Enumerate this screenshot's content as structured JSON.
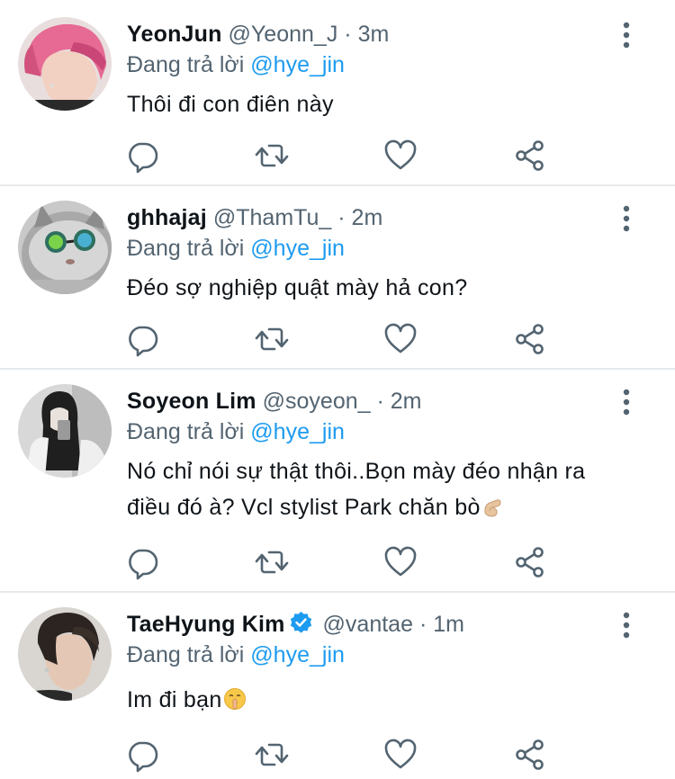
{
  "colors": {
    "accent": "#1d9bf0",
    "text_primary": "#0f1419",
    "text_secondary": "#536471",
    "divider": "#e6e9ec",
    "icon": "#536471"
  },
  "tweets": [
    {
      "display_name": "YeonJun",
      "handle": "@Yeonn_J",
      "separator": "·",
      "time": "3m",
      "reply_prefix": "Đang trả lời",
      "reply_to": "@hye_jin",
      "text": "Thôi đi con điên này",
      "verified": false,
      "avatar_icon": "avatar-pink-hair-person"
    },
    {
      "display_name": "ghhajaj",
      "handle": "@ThamTu_",
      "separator": "·",
      "time": "2m",
      "reply_prefix": "Đang trả lời",
      "reply_to": "@hye_jin",
      "text": "Đéo sợ nghiệp quật mày hả con?",
      "verified": false,
      "avatar_icon": "avatar-cat-with-sunglasses"
    },
    {
      "display_name": "Soyeon Lim",
      "handle": "@soyeon_",
      "separator": "·",
      "time": "2m",
      "reply_prefix": "Đang trả lời",
      "reply_to": "@hye_jin",
      "text_line1": "Nó chỉ nói sự thật thôi..Bọn mày đéo nhận ra",
      "text_line2": "điều đó à? Vcl stylist Park chăn bò",
      "verified": false,
      "avatar_icon": "avatar-mirror-selfie"
    },
    {
      "display_name": "TaeHyung Kim",
      "handle": "@vantae",
      "separator": "·",
      "time": "1m",
      "reply_prefix": "Đang trả lời",
      "reply_to": "@hye_jin",
      "text": "Im đi bạn",
      "verified": true,
      "avatar_icon": "avatar-dark-hair-person"
    }
  ],
  "icons": {
    "reply": "reply-icon",
    "retweet": "retweet-icon",
    "like": "heart-icon",
    "share": "share-icon",
    "more": "more-vertical-icon",
    "verified": "verified-badge-icon",
    "emoji_pinch": "pinching-hand-emoji",
    "emoji_shush": "shushing-face-emoji"
  }
}
